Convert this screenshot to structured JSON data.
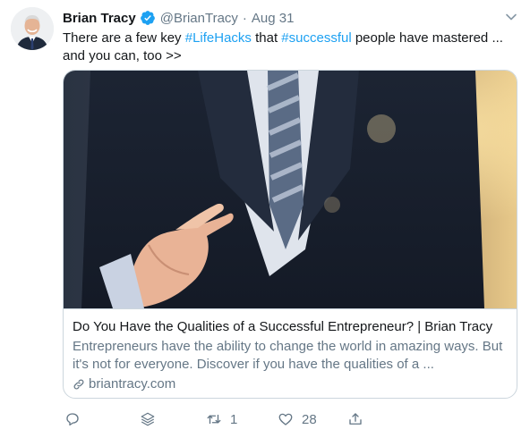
{
  "tweet": {
    "author_name": "Brian Tracy",
    "handle": "@BrianTracy",
    "separator": "·",
    "date": "Aug 31",
    "text_parts": {
      "t1": "There are a few key ",
      "h1": "#LifeHacks",
      "t2": " that ",
      "h2": "#successful",
      "t3": " people have mastered ... and you can, too >>"
    }
  },
  "card": {
    "title": "Do You Have the Qualities of a Successful Entrepreneur? | Brian Tracy",
    "description": "Entrepreneurs have the ability to change the world in amazing ways. But it's not for everyone. Discover if you have the qualities of a ...",
    "domain": "briantracy.com"
  },
  "actions": {
    "retweet_count": "1",
    "like_count": "28"
  },
  "icons": {
    "verified": "verified-badge-icon",
    "caret": "chevron-down-icon",
    "reply": "reply-icon",
    "share_layer": "layers-icon",
    "retweet": "retweet-icon",
    "like": "heart-icon",
    "share": "share-icon",
    "link": "link-icon"
  },
  "colors": {
    "link_blue": "#1da1f2",
    "secondary_text": "#657786",
    "border": "#ccd6dd"
  }
}
